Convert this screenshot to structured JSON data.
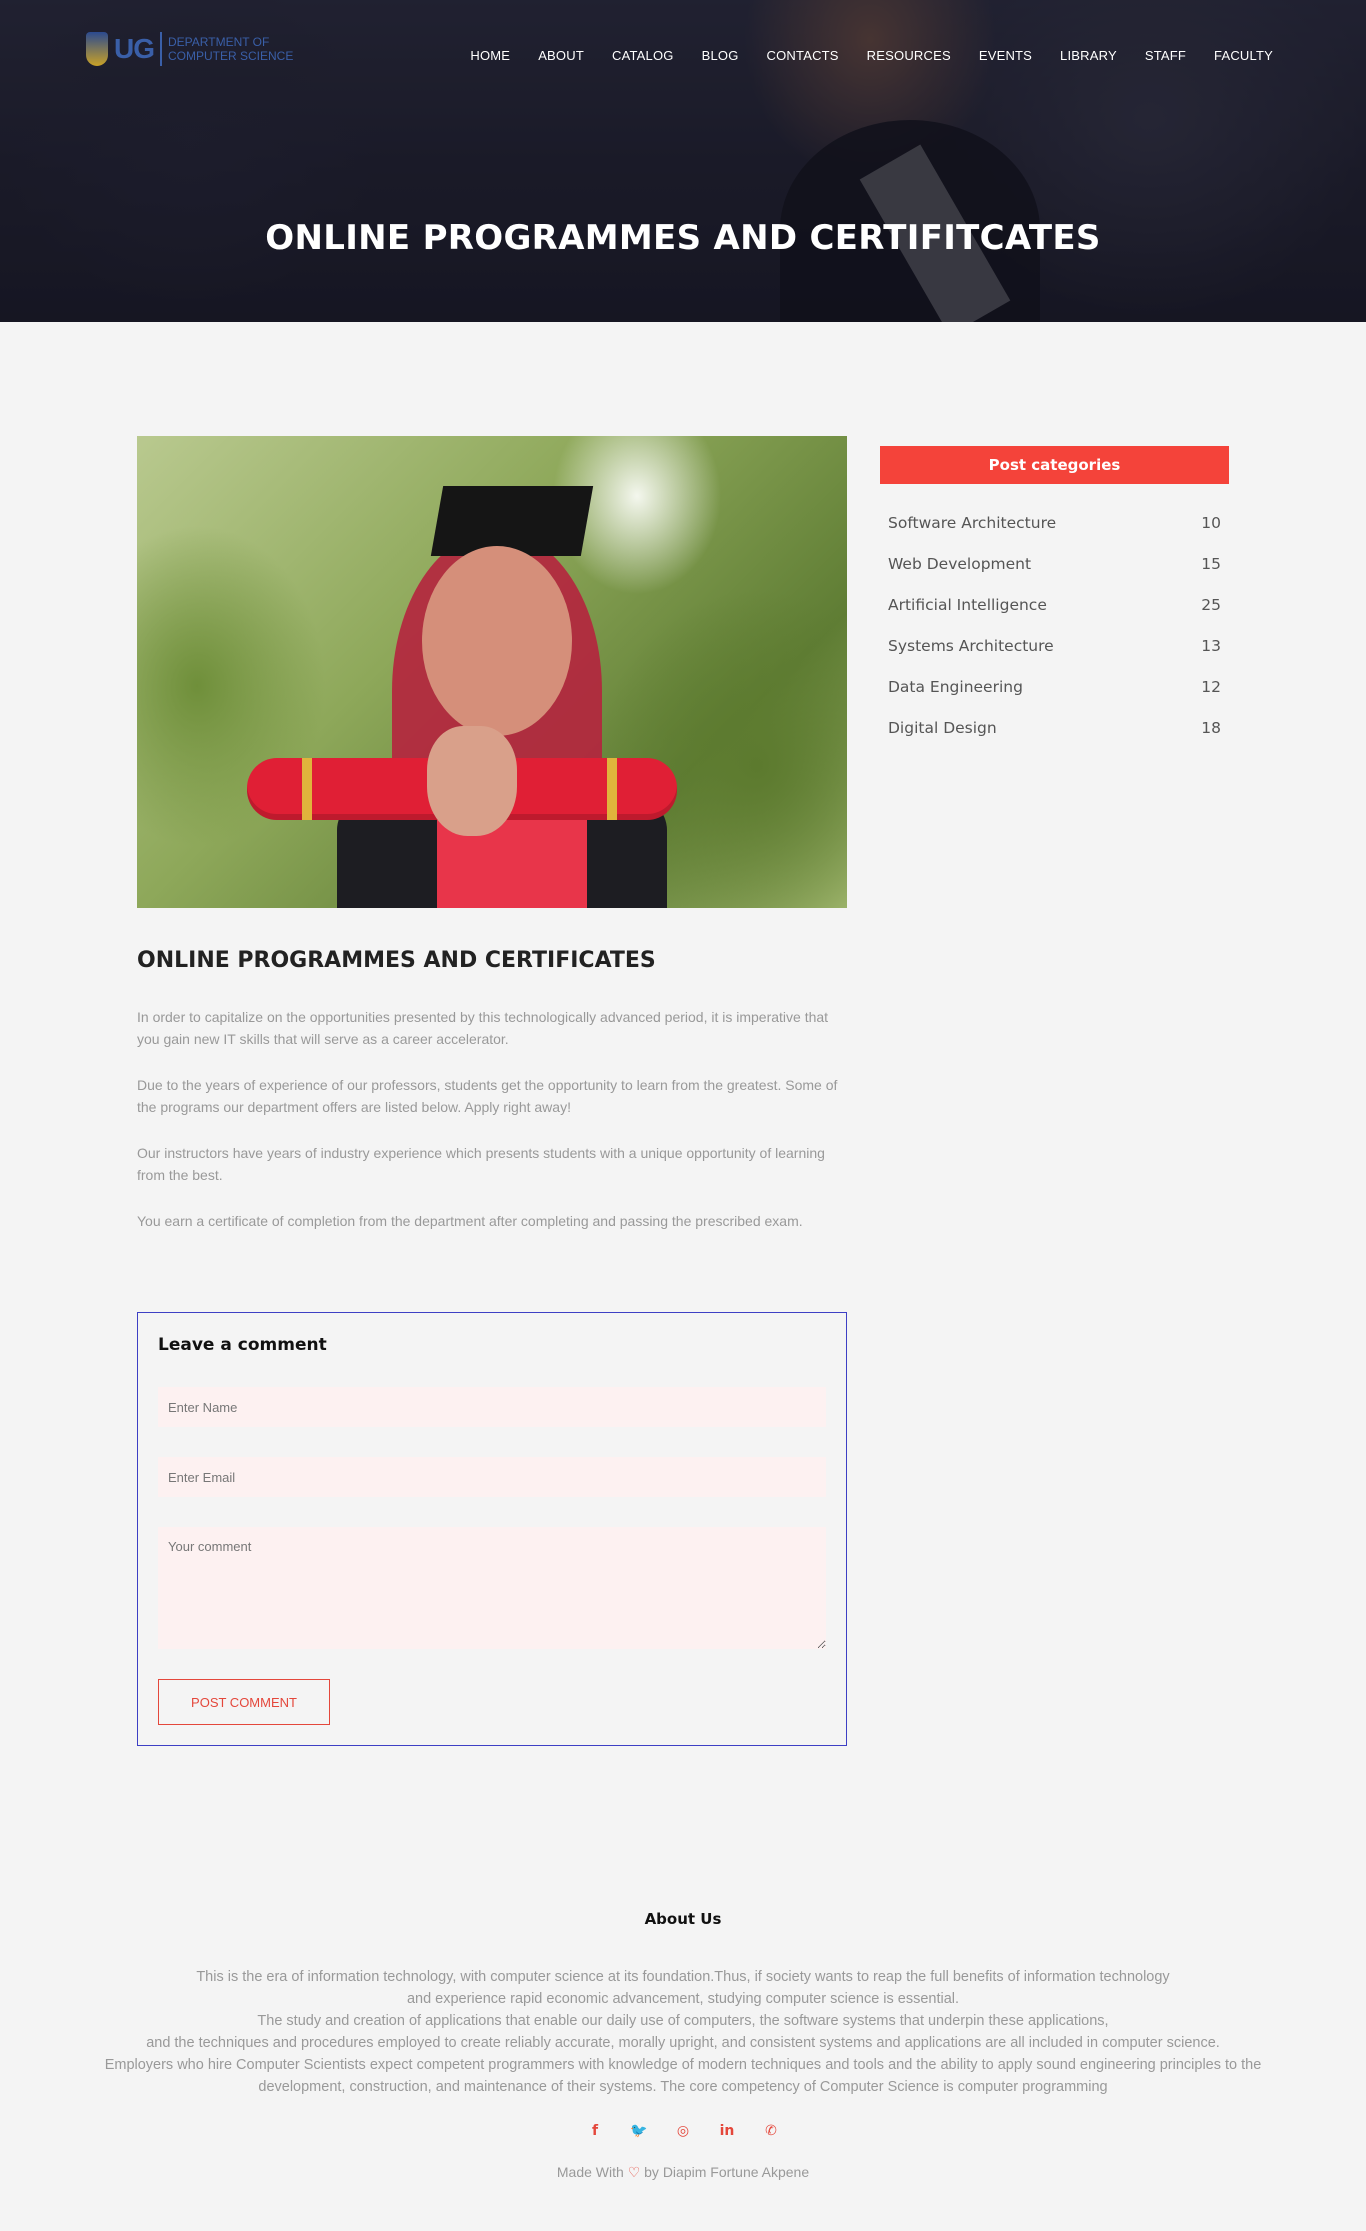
{
  "header": {
    "logo_ug": "UG",
    "logo_line1": "DEPARTMENT OF",
    "logo_line2": "COMPUTER SCIENCE",
    "nav": [
      "HOME",
      "ABOUT",
      "CATALOG",
      "BLOG",
      "CONTACTS",
      "RESOURCES",
      "EVENTS",
      "LIBRARY",
      "STAFF",
      "FACULTY"
    ],
    "title": "ONLINE PROGRAMMES AND CERTIFITCATES"
  },
  "post": {
    "title": "ONLINE PROGRAMMES AND CERTIFICATES",
    "paragraphs": [
      "In order to capitalize on the opportunities presented by this technologically advanced period, it is imperative that you gain new IT skills that will serve as a career accelerator.",
      "Due to the years of experience of our professors, students get the opportunity to learn from the greatest. Some of the programs our department offers are listed below. Apply right away!",
      "Our instructors have years of industry experience which presents students with a unique opportunity of learning from the best.",
      "You earn a certificate of completion from the department after completing and passing the prescribed exam."
    ]
  },
  "comment": {
    "title": "Leave a comment",
    "name_placeholder": "Enter Name",
    "email_placeholder": "Enter Email",
    "comment_placeholder": "Your comment",
    "button": "POST COMMENT"
  },
  "sidebar": {
    "header": "Post categories",
    "categories": [
      {
        "name": "Software Architecture",
        "count": "10"
      },
      {
        "name": "Web Development",
        "count": "15"
      },
      {
        "name": "Artificial Intelligence",
        "count": "25"
      },
      {
        "name": "Systems Architecture",
        "count": "13"
      },
      {
        "name": "Data Engineering",
        "count": "12"
      },
      {
        "name": "Digital Design",
        "count": "18"
      }
    ]
  },
  "footer": {
    "about_title": "About Us",
    "about_lines": [
      "This is the era of information technology, with computer science at its foundation.Thus, if society wants to reap the full benefits of information technology",
      "and experience rapid economic advancement, studying computer science is essential.",
      "The study and creation of applications that enable our daily use of computers, the software systems that underpin these applications,",
      "and the techniques and procedures employed to create reliably accurate, morally upright, and consistent systems and applications are all included in computer science.",
      "Employers who hire Computer Scientists expect competent programmers with knowledge of modern techniques and tools and the ability to apply sound engineering principles to the",
      "development, construction, and maintenance of their systems. The core competency of Computer Science is computer programming"
    ],
    "socials": [
      {
        "icon": "facebook-icon",
        "glyph": "f"
      },
      {
        "icon": "twitter-icon",
        "glyph": "🐦"
      },
      {
        "icon": "instagram-icon",
        "glyph": "◎"
      },
      {
        "icon": "linkedin-icon",
        "glyph": "in"
      },
      {
        "icon": "whatsapp-icon",
        "glyph": "✆"
      }
    ],
    "made_prefix": "Made With",
    "made_heart": "♡",
    "made_suffix": "by Diapim Fortune Akpene"
  },
  "colors": {
    "accent": "#f4433a",
    "comment_border": "#3d3fc4",
    "input_bg": "#fdf1f1"
  }
}
